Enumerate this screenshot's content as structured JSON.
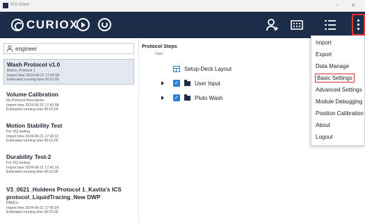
{
  "window": {
    "title": "ICS Client"
  },
  "header": {
    "logo_text": "CURIOX",
    "menu_items": [
      "Import",
      "Export",
      "Data Manage",
      "Basic Settings",
      "Advanced Settings",
      "Module Debugging",
      "Position Calibration",
      "About",
      "Logout"
    ],
    "highlighted_menu_item": "Basic Settings"
  },
  "left": {
    "user": "engineer",
    "protocols": [
      {
        "name": "Wash Protocol v1.0",
        "desc": "Marco_Protocol 1",
        "import_time": "Import time 2024-06-21 17:42:05",
        "running_time": "Estimated running time 00:01:00"
      },
      {
        "name": "Volume Calibration",
        "desc": "No Protocol Description",
        "import_time": "Import time 2024-06-21 17:42:08",
        "running_time": "Estimated running time 00:01:00"
      },
      {
        "name": "Motion Stability Test",
        "desc": "For OQ testing",
        "import_time": "Import time 2024-06-21 17:42:12",
        "running_time": "Estimated running time 00:01:00"
      },
      {
        "name": "Durability Test-2",
        "desc": "For OQ testing",
        "import_time": "Import time 2024-06-21 17:42:16",
        "running_time": "Estimated running time 00:01:00"
      },
      {
        "name": "V3_0621_Holdens Protocol 1_Kavita's ICS protocol_LiquidTracing_New DWP",
        "desc": "PBMCs",
        "import_time": "Import time 2024-06-21 17:42:24",
        "running_time": "Estimated running time 00:01:00"
      }
    ]
  },
  "steps": {
    "title": "Protocol Steps",
    "start": "Start",
    "items": [
      "Setup-Deck Layout",
      "User Input",
      "Pluto Wash"
    ]
  },
  "colors": {
    "header_bg": "#1b2d49",
    "accent": "#2d7fd6",
    "highlight": "#d33333"
  }
}
